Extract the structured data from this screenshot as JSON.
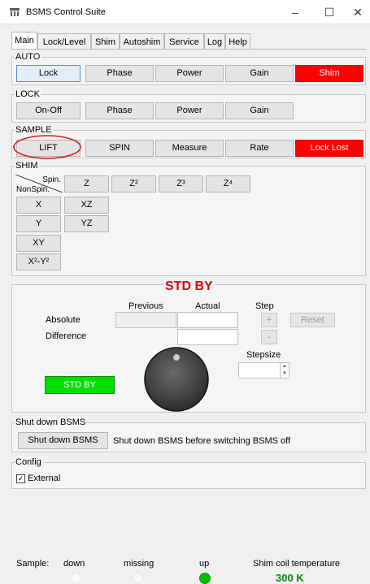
{
  "window": {
    "title": "BSMS Control Suite",
    "minimize": "–",
    "maximize": "☐",
    "close": "✕"
  },
  "tabs": [
    "Main",
    "Lock/Level",
    "Shim",
    "Autoshim",
    "Service",
    "Log",
    "Help"
  ],
  "auto": {
    "title": "AUTO",
    "buttons": [
      "Lock",
      "Phase",
      "Power",
      "Gain",
      "Shim"
    ]
  },
  "lock": {
    "title": "LOCK",
    "buttons": [
      "On-Off",
      "Phase",
      "Power",
      "Gain"
    ]
  },
  "sample": {
    "title": "SAMPLE",
    "buttons": [
      "LIFT",
      "SPIN",
      "Measure",
      "Rate",
      "Lock Lost"
    ]
  },
  "shim": {
    "title": "SHIM",
    "corner_spin": "Spin.",
    "corner_nonspin": "NonSpin.",
    "spin_buttons": [
      "Z",
      "Z²",
      "Z³",
      "Z⁴"
    ],
    "rows": [
      [
        "X",
        "XZ"
      ],
      [
        "Y",
        "YZ"
      ],
      [
        "XY"
      ],
      [
        "X²-Y²"
      ]
    ]
  },
  "stdby": {
    "title": "STD BY",
    "col_previous": "Previous",
    "col_actual": "Actual",
    "col_step": "Step",
    "row_absolute": "Absolute",
    "row_difference": "Difference",
    "plus": "+",
    "minus": "-",
    "reset": "Reset",
    "stepsize": "Stepsize",
    "stdby_button": "STD BY"
  },
  "shutdown": {
    "title": "Shut down BSMS",
    "button": "Shut down BSMS",
    "note": "Shut down BSMS before switching BSMS off"
  },
  "config": {
    "title": "Config",
    "checkbox_label": "External",
    "checked": true
  },
  "status": {
    "sample_label": "Sample:",
    "down": "down",
    "missing": "missing",
    "up": "up",
    "shim_temp_label": "Shim coil temperature",
    "shim_temp_value": "300 K",
    "up_color": "#00c000"
  }
}
